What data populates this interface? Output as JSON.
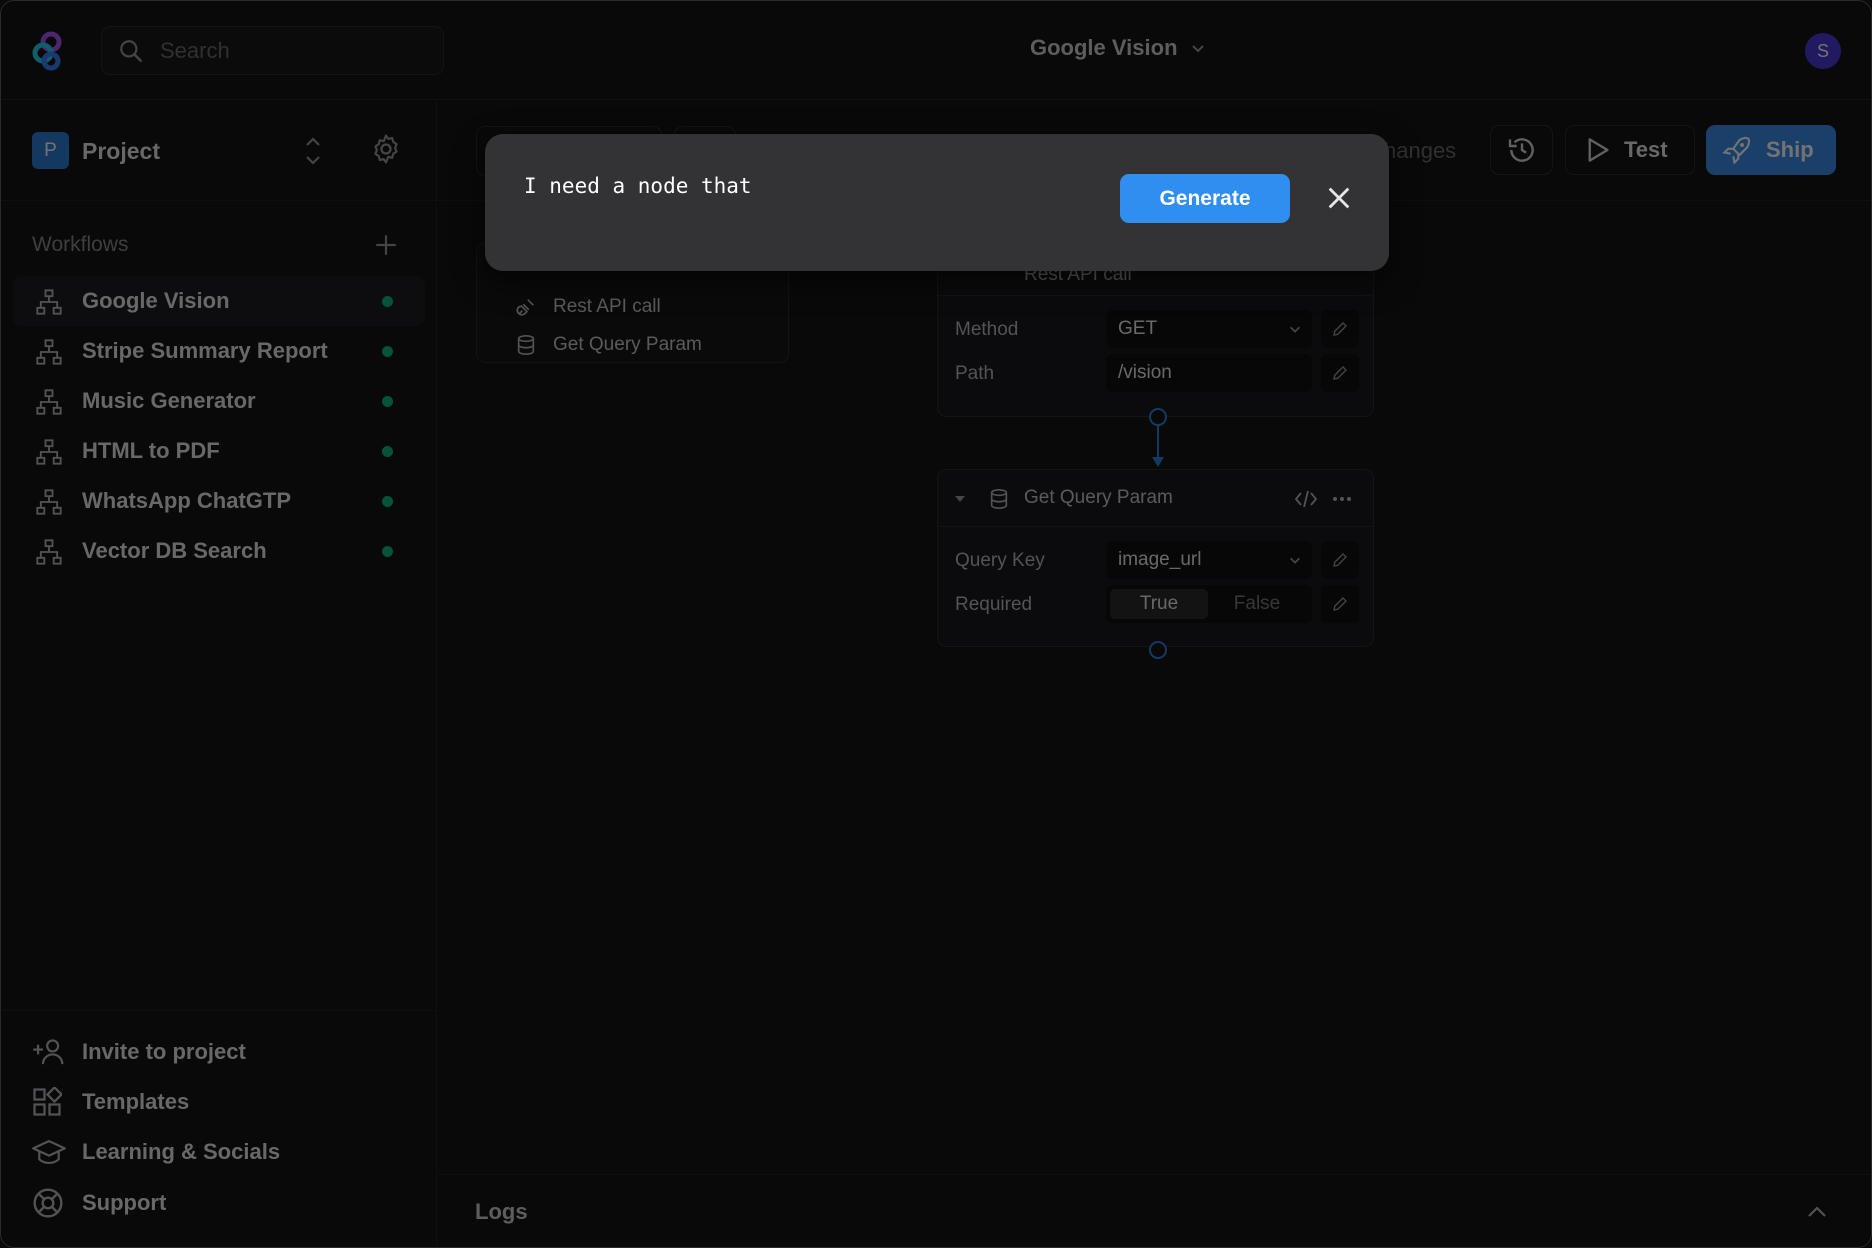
{
  "search": {
    "placeholder": "Search"
  },
  "workflow_title": "Google Vision",
  "avatar": "S",
  "project": {
    "badge": "P",
    "name": "Project"
  },
  "sidebar": {
    "workflows_label": "Workflows",
    "items": [
      {
        "label": "Google Vision",
        "status_color": "#10b981"
      },
      {
        "label": "Stripe Summary Report",
        "status_color": "#10b981"
      },
      {
        "label": "Music Generator",
        "status_color": "#10b981"
      },
      {
        "label": "HTML to PDF",
        "status_color": "#10b981"
      },
      {
        "label": "WhatsApp ChatGTP",
        "status_color": "#10b981"
      },
      {
        "label": "Vector DB Search",
        "status_color": "#10b981"
      }
    ],
    "footer": [
      {
        "label": "Invite to project",
        "icon": "user-plus-icon"
      },
      {
        "label": "Templates",
        "icon": "templates-icon"
      },
      {
        "label": "Learning & Socials",
        "icon": "graduation-cap-icon"
      },
      {
        "label": "Support",
        "icon": "lifebuoy-icon"
      }
    ]
  },
  "toolbar": {
    "changes": "hanges",
    "test": "Test",
    "ship": "Ship",
    "accent": "#3b8fe8"
  },
  "outline": {
    "items": [
      "Rest API call",
      "Get Query Param"
    ]
  },
  "node_rest": {
    "title": "Rest API call",
    "method_label": "Method",
    "method_value": "GET",
    "path_label": "Path",
    "path_value": "/vision"
  },
  "node_query": {
    "title": "Get Query Param",
    "key_label": "Query Key",
    "key_value": "image_url",
    "required_label": "Required",
    "true_label": "True",
    "false_label": "False"
  },
  "logs": {
    "label": "Logs"
  },
  "modal": {
    "prompt": "I need a node that",
    "generate": "Generate"
  }
}
